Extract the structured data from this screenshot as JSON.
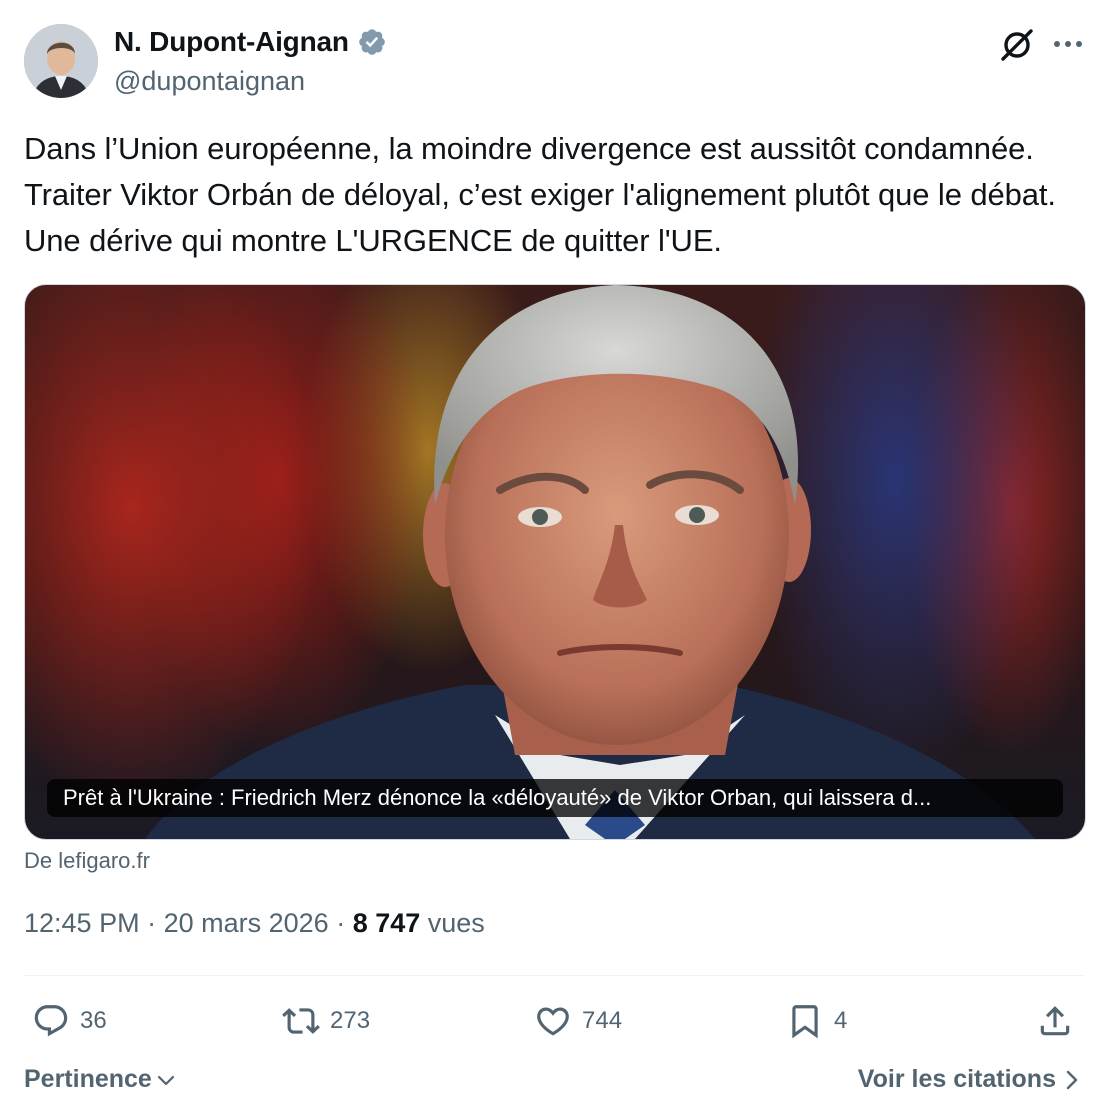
{
  "author": {
    "display_name": "N. Dupont-Aignan",
    "handle": "@dupontaignan",
    "verified": true,
    "verified_color": "#829aab"
  },
  "header_icons": [
    "grok-icon",
    "more-icon"
  ],
  "tweet": {
    "text": "Dans l’Union européenne, la moindre divergence est aussitôt condamnée. Traiter Viktor Orbán de déloyal, c’est exiger l'alignement plutôt que le débat. Une dérive qui montre L'URGENCE de quitter l'UE.",
    "card": {
      "caption": "Prêt à l'Ukraine : Friedrich Merz dénonce la «déloyauté» de Viktor Orban, qui laissera d...",
      "source": "De lefigaro.fr"
    },
    "time": "12:45 PM",
    "sep": " · ",
    "date": "20 mars 2026",
    "views_count": "8 747",
    "views_label": " vues"
  },
  "actions": {
    "replies": "36",
    "reposts": "273",
    "likes": "744",
    "bookmarks": "4"
  },
  "footer": {
    "sort_label": "Pertinence",
    "quotes_label": "Voir les citations"
  },
  "colors": {
    "text": "#0f1419",
    "secondary": "#536471",
    "divider": "#eff3f4"
  }
}
